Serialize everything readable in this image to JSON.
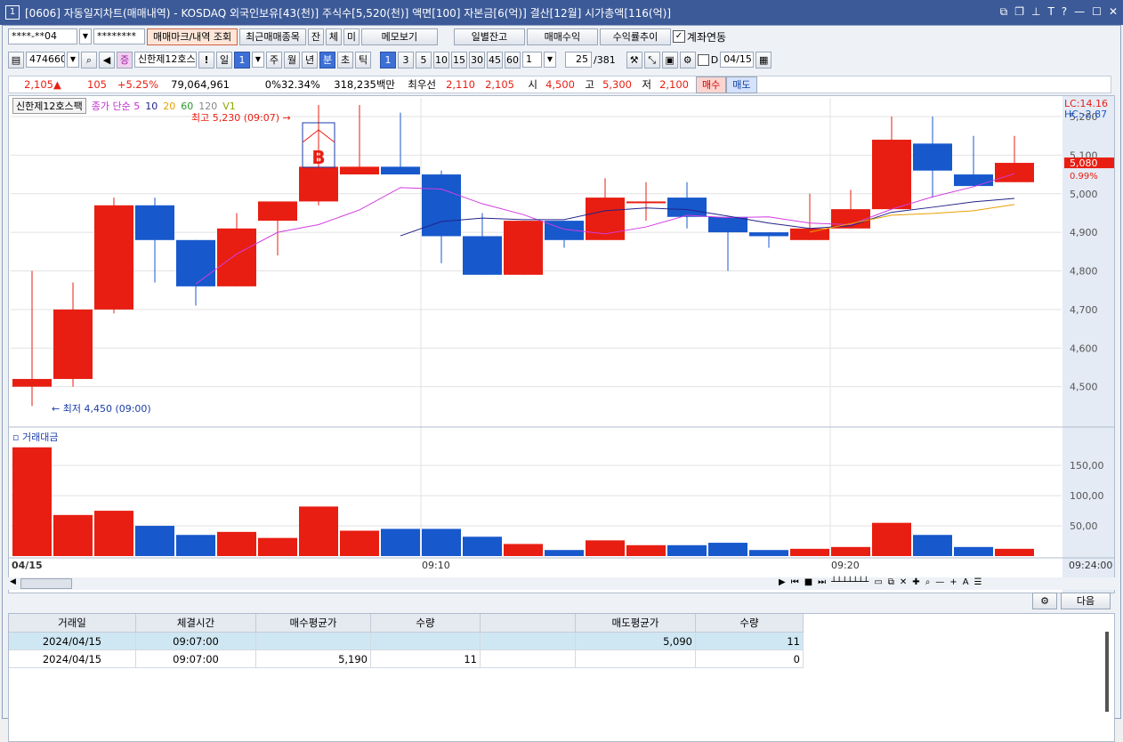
{
  "window": {
    "title": "[0606] 자동일지차트(매매내역) - KOSDAQ 외국인보유[43(천)] 주식수[5,520(천)] 액면[100] 자본금[6(억)] 결산[12월] 시가총액[116(억)]",
    "icon": "1",
    "controls": [
      "minimize",
      "maximize",
      "close"
    ]
  },
  "toolbar1": {
    "account": "****-**04",
    "password": "********",
    "btn_mark": "매매마크/내역 조회",
    "btn_recent": "최근매매종목",
    "btn_jan": "잔",
    "btn_che": "체",
    "btn_mi": "미",
    "btn_memo": "메모보기",
    "btn_daily": "일별잔고",
    "btn_profit": "매매수익",
    "btn_rate": "수익률추이",
    "link_label": "계좌연동"
  },
  "toolbar2": {
    "code": "474660",
    "stock_name": "신한제12호스",
    "periods": [
      "일",
      "1",
      "주",
      "월",
      "년",
      "분",
      "초",
      "틱"
    ],
    "minutes": [
      "1",
      "3",
      "5",
      "10",
      "15",
      "30",
      "45",
      "60"
    ],
    "multiplier": "1",
    "count": "25",
    "total": "/381",
    "d_label": "D",
    "date": "04/15"
  },
  "quote": {
    "price": "2,105",
    "change": "105",
    "change_pct": "+5.25%",
    "volume": "79,064,961",
    "turnover": "0%",
    "ratio": "32.34%",
    "amount": "318,235백만",
    "best_label": "최우선",
    "best_ask": "2,110",
    "best_bid": "2,105",
    "open_label": "시",
    "open": "4,500",
    "high_label": "고",
    "high": "5,300",
    "low_label": "저",
    "low": "2,100",
    "buy_btn": "매수",
    "sell_btn": "매도"
  },
  "legend": {
    "name": "신한제12호스팩",
    "ma_label": "종가 단순 5",
    "ma10": "10",
    "ma20": "20",
    "ma60": "60",
    "ma120": "120",
    "v1": "V1",
    "lc": "LC:14.16",
    "hc": "HC:-2.87",
    "high_note": "최고 5,230 (09:07)",
    "low_note": "최저 4,450 (09:00)",
    "buy_mark": "B",
    "price_tag": "5,080",
    "price_pct": "0.99%",
    "vol_title": "거래대금"
  },
  "chart_data": {
    "type": "candlestick",
    "y_ticks": [
      "5,200",
      "5,100",
      "5,000",
      "4,900",
      "4,800",
      "4,700",
      "4,600",
      "4,500"
    ],
    "ylim": [
      4400,
      5230
    ],
    "vol_ticks": [
      "150,00",
      "100,00",
      "50,00"
    ],
    "vol_max": 190,
    "x_labels": [
      "04/15",
      "09:10",
      "09:20",
      "09:24:00"
    ],
    "candles": [
      {
        "o": 4500,
        "h": 4800,
        "l": 4450,
        "c": 4520,
        "v": 180
      },
      {
        "o": 4520,
        "h": 4770,
        "l": 4500,
        "c": 4700,
        "v": 68
      },
      {
        "o": 4700,
        "h": 4990,
        "l": 4690,
        "c": 4970,
        "v": 75
      },
      {
        "o": 4970,
        "h": 4990,
        "l": 4770,
        "c": 4880,
        "v": 50
      },
      {
        "o": 4880,
        "h": 4880,
        "l": 4710,
        "c": 4760,
        "v": 35
      },
      {
        "o": 4760,
        "h": 4950,
        "l": 4760,
        "c": 4910,
        "v": 40
      },
      {
        "o": 4930,
        "h": 4980,
        "l": 4840,
        "c": 4980,
        "v": 30
      },
      {
        "o": 4980,
        "h": 5230,
        "l": 4970,
        "c": 5070,
        "v": 82
      },
      {
        "o": 5050,
        "h": 5230,
        "l": 5050,
        "c": 5070,
        "v": 42
      },
      {
        "o": 5070,
        "h": 5210,
        "l": 5050,
        "c": 5050,
        "v": 45
      },
      {
        "o": 5050,
        "h": 5060,
        "l": 4820,
        "c": 4890,
        "v": 45
      },
      {
        "o": 4890,
        "h": 4950,
        "l": 4790,
        "c": 4790,
        "v": 32
      },
      {
        "o": 4790,
        "h": 4930,
        "l": 4790,
        "c": 4930,
        "v": 20
      },
      {
        "o": 4930,
        "h": 4930,
        "l": 4860,
        "c": 4880,
        "v": 10
      },
      {
        "o": 4880,
        "h": 5040,
        "l": 4880,
        "c": 4990,
        "v": 26
      },
      {
        "o": 4980,
        "h": 5030,
        "l": 4930,
        "c": 4980,
        "v": 18
      },
      {
        "o": 4990,
        "h": 5030,
        "l": 4910,
        "c": 4940,
        "v": 18
      },
      {
        "o": 4940,
        "h": 4940,
        "l": 4800,
        "c": 4900,
        "v": 22
      },
      {
        "o": 4900,
        "h": 4900,
        "l": 4860,
        "c": 4890,
        "v": 10
      },
      {
        "o": 4880,
        "h": 5000,
        "l": 4880,
        "c": 4910,
        "v": 12
      },
      {
        "o": 4910,
        "h": 5010,
        "l": 4910,
        "c": 4960,
        "v": 15
      },
      {
        "o": 4960,
        "h": 5200,
        "l": 4960,
        "c": 5140,
        "v": 55
      },
      {
        "o": 5130,
        "h": 5200,
        "l": 4990,
        "c": 5060,
        "v": 35
      },
      {
        "o": 5050,
        "h": 5150,
        "l": 5020,
        "c": 5020,
        "v": 15
      },
      {
        "o": 5030,
        "h": 5150,
        "l": 5030,
        "c": 5080,
        "v": 12
      }
    ],
    "colors": {
      "up": "#e81e12",
      "down": "#1758cc",
      "ma5": "#d23ce0",
      "ma10": "#222288",
      "ma20": "#e8a000"
    }
  },
  "trades": {
    "headers": [
      "거래일",
      "체결시간",
      "매수평균가",
      "수량",
      "",
      "매도평균가",
      "수량"
    ],
    "rows": [
      [
        "2024/04/15",
        "09:07:00",
        "",
        "",
        "",
        "5,090",
        "11"
      ],
      [
        "2024/04/15",
        "09:07:00",
        "5,190",
        "11",
        "",
        "",
        "0"
      ]
    ],
    "next_btn": "다음"
  }
}
